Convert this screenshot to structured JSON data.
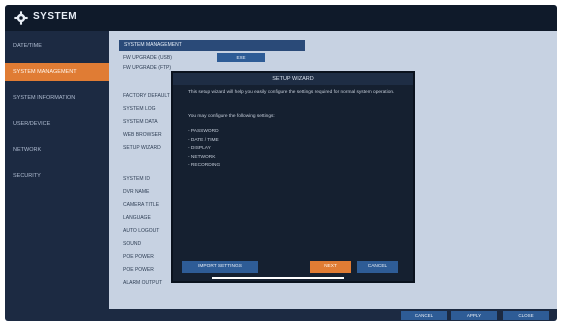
{
  "window": {
    "title": "SYSTEM",
    "icon": "gear-icon"
  },
  "sidebar": {
    "items": [
      {
        "label": "DATE/TIME",
        "active": false
      },
      {
        "label": "SYSTEM MANAGEMENT",
        "active": true
      },
      {
        "label": "SYSTEM INFORMATION",
        "active": false
      },
      {
        "label": "USER/DEVICE",
        "active": false
      },
      {
        "label": "NETWORK",
        "active": false
      },
      {
        "label": "SECURITY",
        "active": false
      }
    ]
  },
  "main": {
    "section_header": "SYSTEM MANAGEMENT",
    "rows": [
      "FW UPGRADE (USB)",
      "FW UPGRADE (FTP)",
      "FACTORY DEFAULT",
      "SYSTEM LOG",
      "SYSTEM DATA",
      "WEB BROWSER",
      "SETUP WIZARD",
      "SYSTEM ID",
      "DVR NAME",
      "CAMERA TITLE",
      "LANGUAGE",
      "AUTO LOGOUT",
      "SOUND",
      "POE POWER",
      "POE POWER",
      "ALARM OUTPUT"
    ],
    "row_button": "EXE"
  },
  "dialog": {
    "title": "SETUP WIZARD",
    "message": "This setup wizard will help you easily configure the settings required for normal system operation.",
    "prompt": "You may configure the following settings:",
    "items": [
      "- PASSWORD",
      "- DATE / TIME",
      "- DISPLAY",
      "- NETWORK",
      "- RECORDING"
    ],
    "import_button": "IMPORT SETTINGS",
    "next_button": "NEXT",
    "cancel_button": "CANCEL"
  },
  "footer": {
    "cancel": "CANCEL",
    "apply": "APPLY",
    "close": "CLOSE"
  },
  "colors": {
    "accent": "#e07c34",
    "primary": "#2e5c96",
    "sidebar_bg": "#1c2a42",
    "titlebar_bg": "#0f1a2a"
  }
}
